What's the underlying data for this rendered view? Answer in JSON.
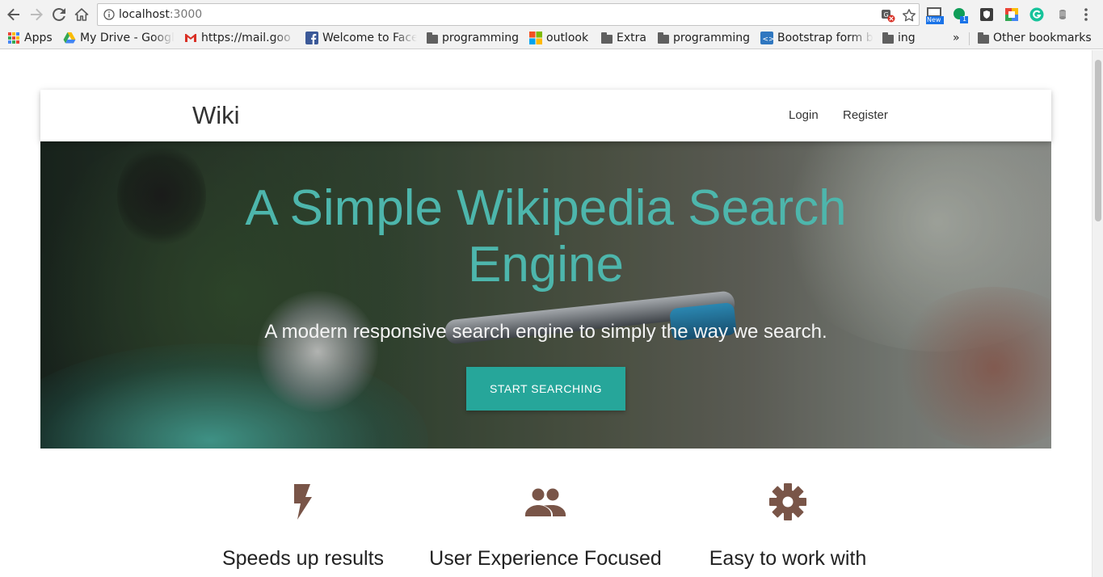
{
  "browser": {
    "url_host": "localhost",
    "url_port": ":3000",
    "extension_badge": "New",
    "extension_count": "1",
    "bookmarks": [
      {
        "label": "Apps",
        "icon": "apps-grid-icon"
      },
      {
        "label": "My Drive - Google",
        "icon": "google-drive-icon"
      },
      {
        "label": "https://mail.goo",
        "icon": "gmail-icon"
      },
      {
        "label": "Welcome to Face",
        "icon": "facebook-icon"
      },
      {
        "label": "programming",
        "icon": "folder-icon"
      },
      {
        "label": "outlook",
        "icon": "microsoft-icon"
      },
      {
        "label": "Extra",
        "icon": "folder-icon"
      },
      {
        "label": "programming",
        "icon": "folder-icon"
      },
      {
        "label": "Bootstrap form b",
        "icon": "bootstrap-icon"
      },
      {
        "label": "ing",
        "icon": "folder-icon"
      }
    ],
    "overflow": "»",
    "other_bookmarks": "Other bookmarks"
  },
  "page": {
    "brand": "Wiki",
    "nav": {
      "login": "Login",
      "register": "Register"
    },
    "hero": {
      "title": "A Simple Wikipedia Search Engine",
      "subtitle": "A modern responsive search engine to simply the way we search.",
      "button": "START SEARCHING"
    },
    "features": [
      {
        "title": "Speeds up results",
        "icon": "flash-icon"
      },
      {
        "title": "User Experience Focused",
        "icon": "people-icon"
      },
      {
        "title": "Easy to work with",
        "icon": "gear-icon"
      }
    ]
  },
  "colors": {
    "accent": "#26a69a",
    "hero_title": "#4db6ac",
    "feature_icon": "#795548"
  }
}
